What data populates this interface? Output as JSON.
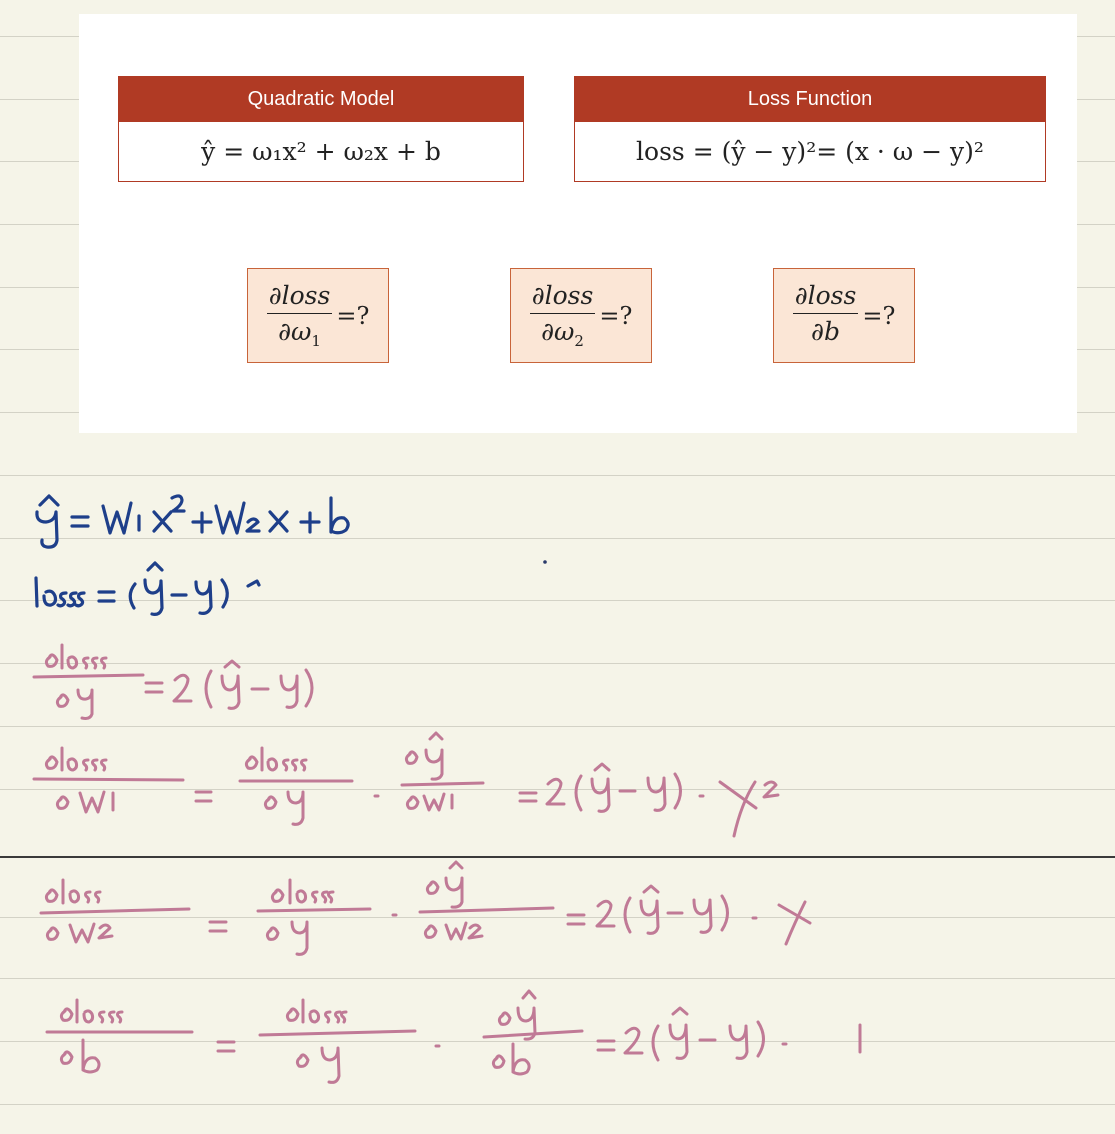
{
  "card": {
    "model_box": {
      "title": "Quadratic Model",
      "formula": "ŷ = ω₁x² + ω₂x + b"
    },
    "loss_box": {
      "title": "Loss Function",
      "formula": "loss = (ŷ − y)²= (x · ω − y)²"
    },
    "derivatives": [
      {
        "numerator": "∂loss",
        "denominator": "∂ω",
        "subscript": "1",
        "suffix": "=?"
      },
      {
        "numerator": "∂loss",
        "denominator": "∂ω",
        "subscript": "2",
        "suffix": "=?"
      },
      {
        "numerator": "∂loss",
        "denominator": "∂b",
        "subscript": "",
        "suffix": "=?"
      }
    ]
  },
  "handwritten_notes": [
    "ŷ = W₁x² + W₂x + b",
    "loss = (ŷ − y)²",
    "∂loss/∂ŷ = 2(ŷ − y)",
    "∂loss/∂W₁ = ∂loss/∂ŷ · ∂ŷ/∂W₁ = 2(ŷ − y) · x²",
    "∂loss/∂W₂ = ∂loss/∂ŷ · ∂ŷ/∂W₂ = 2(ŷ − y) · x",
    "∂loss/∂b = ∂loss/∂ŷ · ∂ŷ/∂b = 2(ŷ − y) · 1"
  ],
  "colors": {
    "header": "#b03a24",
    "derivative_fill": "#fbe6d6",
    "ink_blue": "#1e3f8a",
    "ink_pink": "#c07a96",
    "paper": "#f5f4e8"
  }
}
